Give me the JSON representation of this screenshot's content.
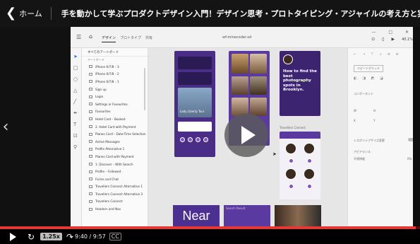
{
  "topbar": {
    "back_icon": "chevron-left-icon",
    "home_label": "ホーム",
    "course_title": "手を動かして学ぶプロダクトデザイン入門！デザイン思考・プロトタイピング・アジャイルの考え方と実践"
  },
  "xd": {
    "tabs": [
      "デザイン",
      "プロトタイプ",
      "共有"
    ],
    "document_name": "wf-minecoder.xd",
    "zoom": "40.1%",
    "window_controls": "— □ ✕",
    "layers_header": "すべてのアートボード",
    "layers_section": "アートボード",
    "layers": [
      "iPhone 6/7/8 – 3",
      "iPhone 6/7/8 – 2",
      "iPhone 6/7/8 – 1",
      "Sign up",
      "Login",
      "Settings or Favourites",
      "Favourites",
      "Hotel Card – Booked",
      "2. Hotel Card with Payment",
      "Planes Card – Date-Time Selection",
      "Active Messages",
      "Profile Alternative 1",
      "Planes Card with Payment",
      "1. Discover – With Search",
      "Profile – Followed",
      "Forms and Chat",
      "Travellers Connect Alternative 1",
      "Travellers Connect Alternative 3",
      "Travellers Connect",
      "Headers and Nav"
    ],
    "canvas": {
      "liberty_title": "Lady Liberty Tour",
      "photo_heading": "How to find the best photography spots in Brooklyn.",
      "connect_label": "Travellers Connect",
      "near_label": "Near",
      "search_result": "Search Result"
    },
    "props": {
      "repeat_grid": "リピートグリッド",
      "component": "コンポーネント",
      "responsive": "レスポンシブサイズ変更",
      "appearance": "アピアランス",
      "opacity": "不透明度",
      "opacity_value": "0%",
      "w_label": "W",
      "h_label": "H",
      "x_label": "X",
      "y_label": "Y"
    }
  },
  "player": {
    "progress_fraction": 0.99,
    "speed": "1.25x",
    "time": "9:40 / 9:57",
    "play_icon": "play-icon",
    "replay_icon": "replay-icon",
    "forward_icon": "forward-icon",
    "cc_label": "CC"
  },
  "colors": {
    "progress": "#e53935",
    "artboard_purple": "#4a2d86",
    "xd_select_blue": "#1473e6"
  }
}
